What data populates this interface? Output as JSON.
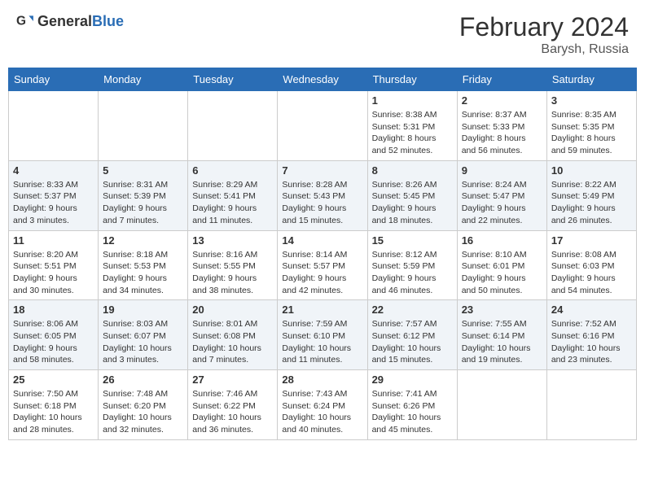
{
  "header": {
    "logo_general": "General",
    "logo_blue": "Blue",
    "month_year": "February 2024",
    "location": "Barysh, Russia"
  },
  "days_of_week": [
    "Sunday",
    "Monday",
    "Tuesday",
    "Wednesday",
    "Thursday",
    "Friday",
    "Saturday"
  ],
  "weeks": [
    [
      {
        "day": "",
        "info": ""
      },
      {
        "day": "",
        "info": ""
      },
      {
        "day": "",
        "info": ""
      },
      {
        "day": "",
        "info": ""
      },
      {
        "day": "1",
        "info": "Sunrise: 8:38 AM\nSunset: 5:31 PM\nDaylight: 8 hours\nand 52 minutes."
      },
      {
        "day": "2",
        "info": "Sunrise: 8:37 AM\nSunset: 5:33 PM\nDaylight: 8 hours\nand 56 minutes."
      },
      {
        "day": "3",
        "info": "Sunrise: 8:35 AM\nSunset: 5:35 PM\nDaylight: 8 hours\nand 59 minutes."
      }
    ],
    [
      {
        "day": "4",
        "info": "Sunrise: 8:33 AM\nSunset: 5:37 PM\nDaylight: 9 hours\nand 3 minutes."
      },
      {
        "day": "5",
        "info": "Sunrise: 8:31 AM\nSunset: 5:39 PM\nDaylight: 9 hours\nand 7 minutes."
      },
      {
        "day": "6",
        "info": "Sunrise: 8:29 AM\nSunset: 5:41 PM\nDaylight: 9 hours\nand 11 minutes."
      },
      {
        "day": "7",
        "info": "Sunrise: 8:28 AM\nSunset: 5:43 PM\nDaylight: 9 hours\nand 15 minutes."
      },
      {
        "day": "8",
        "info": "Sunrise: 8:26 AM\nSunset: 5:45 PM\nDaylight: 9 hours\nand 18 minutes."
      },
      {
        "day": "9",
        "info": "Sunrise: 8:24 AM\nSunset: 5:47 PM\nDaylight: 9 hours\nand 22 minutes."
      },
      {
        "day": "10",
        "info": "Sunrise: 8:22 AM\nSunset: 5:49 PM\nDaylight: 9 hours\nand 26 minutes."
      }
    ],
    [
      {
        "day": "11",
        "info": "Sunrise: 8:20 AM\nSunset: 5:51 PM\nDaylight: 9 hours\nand 30 minutes."
      },
      {
        "day": "12",
        "info": "Sunrise: 8:18 AM\nSunset: 5:53 PM\nDaylight: 9 hours\nand 34 minutes."
      },
      {
        "day": "13",
        "info": "Sunrise: 8:16 AM\nSunset: 5:55 PM\nDaylight: 9 hours\nand 38 minutes."
      },
      {
        "day": "14",
        "info": "Sunrise: 8:14 AM\nSunset: 5:57 PM\nDaylight: 9 hours\nand 42 minutes."
      },
      {
        "day": "15",
        "info": "Sunrise: 8:12 AM\nSunset: 5:59 PM\nDaylight: 9 hours\nand 46 minutes."
      },
      {
        "day": "16",
        "info": "Sunrise: 8:10 AM\nSunset: 6:01 PM\nDaylight: 9 hours\nand 50 minutes."
      },
      {
        "day": "17",
        "info": "Sunrise: 8:08 AM\nSunset: 6:03 PM\nDaylight: 9 hours\nand 54 minutes."
      }
    ],
    [
      {
        "day": "18",
        "info": "Sunrise: 8:06 AM\nSunset: 6:05 PM\nDaylight: 9 hours\nand 58 minutes."
      },
      {
        "day": "19",
        "info": "Sunrise: 8:03 AM\nSunset: 6:07 PM\nDaylight: 10 hours\nand 3 minutes."
      },
      {
        "day": "20",
        "info": "Sunrise: 8:01 AM\nSunset: 6:08 PM\nDaylight: 10 hours\nand 7 minutes."
      },
      {
        "day": "21",
        "info": "Sunrise: 7:59 AM\nSunset: 6:10 PM\nDaylight: 10 hours\nand 11 minutes."
      },
      {
        "day": "22",
        "info": "Sunrise: 7:57 AM\nSunset: 6:12 PM\nDaylight: 10 hours\nand 15 minutes."
      },
      {
        "day": "23",
        "info": "Sunrise: 7:55 AM\nSunset: 6:14 PM\nDaylight: 10 hours\nand 19 minutes."
      },
      {
        "day": "24",
        "info": "Sunrise: 7:52 AM\nSunset: 6:16 PM\nDaylight: 10 hours\nand 23 minutes."
      }
    ],
    [
      {
        "day": "25",
        "info": "Sunrise: 7:50 AM\nSunset: 6:18 PM\nDaylight: 10 hours\nand 28 minutes."
      },
      {
        "day": "26",
        "info": "Sunrise: 7:48 AM\nSunset: 6:20 PM\nDaylight: 10 hours\nand 32 minutes."
      },
      {
        "day": "27",
        "info": "Sunrise: 7:46 AM\nSunset: 6:22 PM\nDaylight: 10 hours\nand 36 minutes."
      },
      {
        "day": "28",
        "info": "Sunrise: 7:43 AM\nSunset: 6:24 PM\nDaylight: 10 hours\nand 40 minutes."
      },
      {
        "day": "29",
        "info": "Sunrise: 7:41 AM\nSunset: 6:26 PM\nDaylight: 10 hours\nand 45 minutes."
      },
      {
        "day": "",
        "info": ""
      },
      {
        "day": "",
        "info": ""
      }
    ]
  ]
}
